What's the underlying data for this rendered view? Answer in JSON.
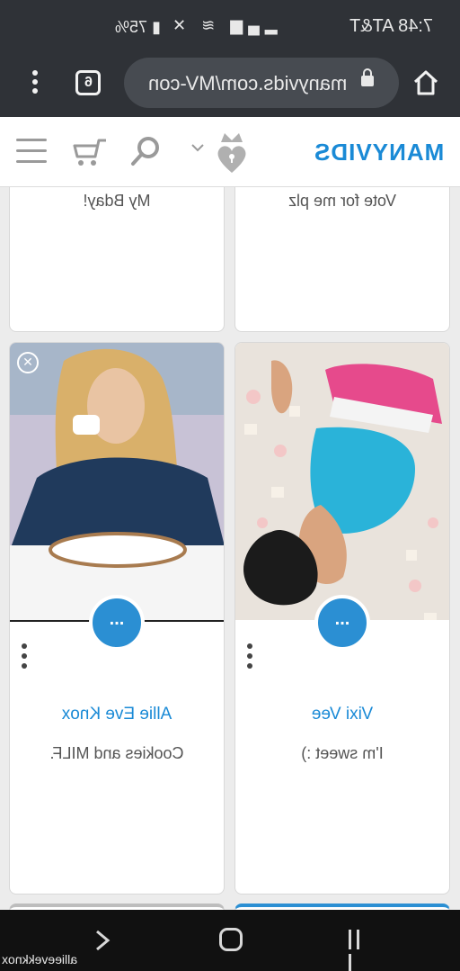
{
  "status_bar": {
    "carrier_time": "7:48 AT&T",
    "battery": "75%"
  },
  "browser": {
    "url": "manyvids.com/MV-con",
    "tab_count": "6"
  },
  "site": {
    "logo": "MANYVIDS"
  },
  "cards": [
    {
      "name": "",
      "description": "Vote for me plz"
    },
    {
      "name": "",
      "description": "My Bday!"
    },
    {
      "name": "Vixi Vee",
      "description": "I'm sweet :)",
      "menu_label": "..."
    },
    {
      "name": "Allie Eve Knox",
      "description": "Cookies and MILF.",
      "menu_label": "..."
    }
  ],
  "watermark": "allieevekknox",
  "colors": {
    "accent": "#1a8ad6",
    "status_bar": "#2f3237",
    "nav_bar": "#111111"
  }
}
